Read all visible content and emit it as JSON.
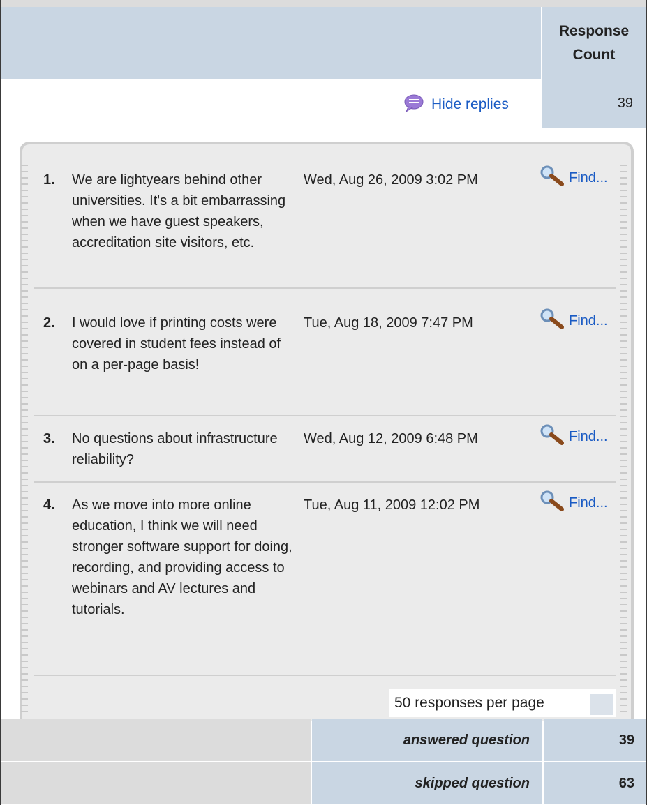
{
  "header": {
    "response_count_label": "Response Count"
  },
  "summary": {
    "response_count": "39",
    "hide_replies_label": "Hide replies",
    "chat_icon": "speech-bubble-icon"
  },
  "replies": [
    {
      "num": "1.",
      "text": "We are lightyears behind other universities. It's a bit embarrassing when we have guest speakers, accreditation site visitors, etc.",
      "date": "Wed, Aug 26, 2009 3:02 PM",
      "find_label": "Find..."
    },
    {
      "num": "2.",
      "text": "I would love if printing costs were covered in student fees instead of on a per-page basis!",
      "date": "Tue, Aug 18, 2009 7:47 PM",
      "find_label": "Find..."
    },
    {
      "num": "3.",
      "text": "No questions about infrastructure reliability?",
      "date": "Wed, Aug 12, 2009 6:48 PM",
      "find_label": "Find..."
    },
    {
      "num": "4.",
      "text": "As we move into more online education, I think we will need stronger software support for doing, recording, and providing access to webinars and AV lectures and tutorials.",
      "date": "Tue, Aug 11, 2009 12:02 PM",
      "find_label": "Find..."
    }
  ],
  "pagination": {
    "per_page_label": "50 responses per page"
  },
  "totals": {
    "answered_label": "answered question",
    "answered_value": "39",
    "skipped_label": "skipped question",
    "skipped_value": "63"
  },
  "colors": {
    "header_bg": "#c9d6e3",
    "link": "#1a5bc4",
    "panel_bg": "#ebebeb",
    "summary_left_bg": "#dcdcdc"
  }
}
